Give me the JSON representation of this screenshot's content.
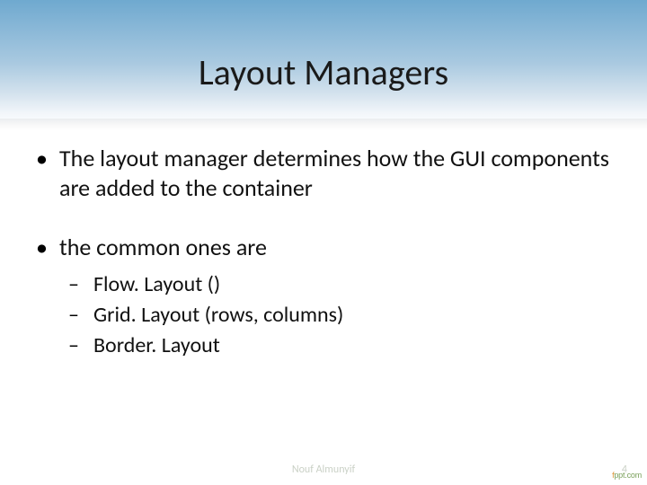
{
  "title": "Layout Managers",
  "bullets": [
    {
      "text": "The layout manager determines how the GUI components are added to the container",
      "sub": []
    },
    {
      "text": "the common ones are",
      "sub": [
        "Flow. Layout ()",
        "Grid. Layout (rows, columns)",
        "Border. Layout"
      ]
    }
  ],
  "footer": "Nouf Almunyif",
  "page": "4",
  "brand_prefix": "f",
  "brand_suffix": "ppt.com"
}
